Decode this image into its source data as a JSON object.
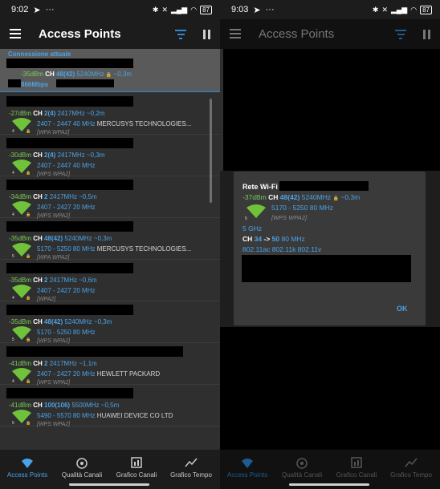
{
  "left": {
    "status": {
      "time": "9:02",
      "battery": "87"
    },
    "appbar": {
      "title": "Access Points"
    },
    "current": {
      "title": "Connessione attuale",
      "signal": "-35dBm",
      "ch_label": "CH",
      "ch": "48(42)",
      "freq": "5240MHz",
      "lock": "🔒",
      "dist": "~0,3m",
      "speed": "866Mbps"
    },
    "aps": [
      {
        "signal": "-27dBm",
        "ch": "2(4)",
        "freq": "2417MHz",
        "dist": "~0,2m",
        "range": "2407 - 2447 40 MHz",
        "vendor": "MERCUSYS TECHNOLOGIES...",
        "sec": "[WPA WPA2]",
        "band": "4"
      },
      {
        "signal": "-30dBm",
        "ch": "2(4)",
        "freq": "2417MHz",
        "dist": "~0,3m",
        "range": "2407 - 2447 40 MHz",
        "vendor": "",
        "sec": "[WPS WPA2]",
        "band": "4"
      },
      {
        "signal": "-34dBm",
        "ch": "2",
        "freq": "2417MHz",
        "dist": "~0,5m",
        "range": "2407 - 2427 20 MHz",
        "vendor": "",
        "sec": "[WPS WPA2]",
        "band": "4"
      },
      {
        "signal": "-35dBm",
        "ch": "48(42)",
        "freq": "5240MHz",
        "dist": "~0,3m",
        "range": "5170 - 5250 80 MHz",
        "vendor": "MERCUSYS TECHNOLOGIES...",
        "sec": "[WPA WPA2]",
        "band": "5"
      },
      {
        "signal": "-35dBm",
        "ch": "2",
        "freq": "2417MHz",
        "dist": "~0,6m",
        "range": "2407 - 2427 20 MHz",
        "vendor": "",
        "sec": "[WPA2]",
        "band": "4"
      },
      {
        "signal": "-35dBm",
        "ch": "48(42)",
        "freq": "5240MHz",
        "dist": "~0,3m",
        "range": "5170 - 5250 80 MHz",
        "vendor": "",
        "sec": "[WPS WPA2]",
        "band": "5"
      },
      {
        "signal": "-41dBm",
        "ch": "2",
        "freq": "2417MHz",
        "dist": "~1,1m",
        "range": "2407 - 2427 20 MHz",
        "vendor": "HEWLETT PACKARD",
        "sec": "[WPS WPA2]",
        "band": "4"
      },
      {
        "signal": "-41dBm",
        "ch": "100(106)",
        "freq": "5500MHz",
        "dist": "~0,5m",
        "range": "5490 - 5570 80 MHz",
        "vendor": "HUAWEI DEVICE CO LTD",
        "sec": "[WPS WPA2]",
        "band": "5"
      }
    ],
    "nav": [
      {
        "label": "Access Points",
        "icon": "wifi-icon"
      },
      {
        "label": "Qualità Canali",
        "icon": "signal-quality-icon"
      },
      {
        "label": "Grafico Canali",
        "icon": "bar-chart-icon"
      },
      {
        "label": "Grafico Tempo",
        "icon": "line-chart-icon"
      }
    ]
  },
  "right": {
    "status": {
      "time": "9:03",
      "battery": "87"
    },
    "appbar": {
      "title": "Access Points"
    },
    "dialog": {
      "title": "Rete Wi-Fi",
      "signal": "-37dBm",
      "ch_label": "CH",
      "ch": "48(42)",
      "freq": "5240MHz",
      "dist": "~0,3m",
      "range": "5170 - 5250 80 MHz",
      "sec": "[WPS WPA2]",
      "band": "5",
      "freq_band": "5 GHz",
      "ch_from": "34",
      "ch_arrow": "->",
      "ch_to": "50",
      "width": "80 MHz",
      "standards": "802.11ac 802.11k 802.11v",
      "ok": "OK"
    },
    "nav": [
      {
        "label": "Access Points"
      },
      {
        "label": "Qualità Canali"
      },
      {
        "label": "Grafico Canali"
      },
      {
        "label": "Grafico Tempo"
      }
    ]
  },
  "colors": {
    "accent": "#4aa3e8",
    "signal": "#7acb54",
    "wifi": "#6fc23a"
  }
}
